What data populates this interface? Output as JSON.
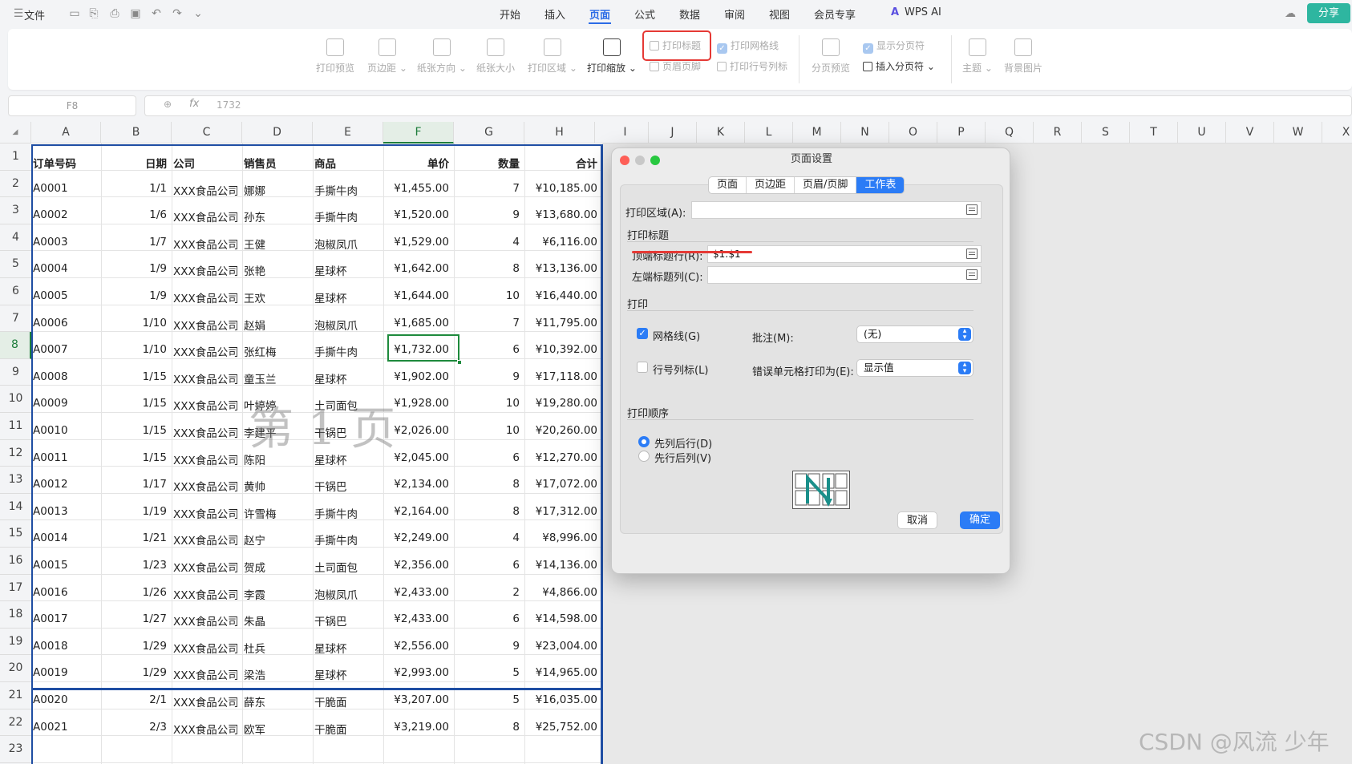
{
  "titlebar": {
    "file_menu": "文件",
    "tabs": [
      "开始",
      "插入",
      "页面",
      "公式",
      "数据",
      "审阅",
      "视图",
      "会员专享"
    ],
    "active_tab": "页面",
    "wps_ai": "WPS AI",
    "share": "分享"
  },
  "ribbon": {
    "print_preview": "打印预览",
    "margins": "页边距",
    "orientation": "纸张方向",
    "paper_size": "纸张大小",
    "print_area": "打印区域",
    "print_scale": "打印缩放",
    "print_titles": "打印标题",
    "header_footer": "页眉页脚",
    "print_gridlines": "打印网格线",
    "print_row_col_headers": "打印行号列标",
    "page_break_preview": "分页预览",
    "show_page_breaks": "显示分页符",
    "insert_page_break": "插入分页符",
    "theme": "主题",
    "background_image": "背景图片"
  },
  "formula_bar": {
    "name_box": "F8",
    "fx": "fx",
    "value": "1732"
  },
  "sheet": {
    "columns": [
      "A",
      "B",
      "C",
      "D",
      "E",
      "F",
      "G",
      "H",
      "I",
      "J",
      "K",
      "L",
      "M",
      "N",
      "O",
      "P",
      "Q",
      "R",
      "S",
      "T",
      "U",
      "V",
      "W",
      "X"
    ],
    "active_column": "F",
    "active_row": "8",
    "row_numbers": [
      "1",
      "2",
      "3",
      "4",
      "5",
      "6",
      "7",
      "8",
      "9",
      "10",
      "11",
      "12",
      "13",
      "14",
      "15",
      "16",
      "17",
      "18",
      "19",
      "20",
      "21",
      "22",
      "23"
    ],
    "headers": [
      "订单号码",
      "日期",
      "公司",
      "销售员",
      "商品",
      "单价",
      "数量",
      "合计"
    ],
    "rows": [
      [
        "A0001",
        "1/1",
        "XXX食品公司",
        "娜娜",
        "手撕牛肉",
        "¥1,455.00",
        "7",
        "¥10,185.00"
      ],
      [
        "A0002",
        "1/6",
        "XXX食品公司",
        "孙东",
        "手撕牛肉",
        "¥1,520.00",
        "9",
        "¥13,680.00"
      ],
      [
        "A0003",
        "1/7",
        "XXX食品公司",
        "王健",
        "泡椒凤爪",
        "¥1,529.00",
        "4",
        "¥6,116.00"
      ],
      [
        "A0004",
        "1/9",
        "XXX食品公司",
        "张艳",
        "星球杯",
        "¥1,642.00",
        "8",
        "¥13,136.00"
      ],
      [
        "A0005",
        "1/9",
        "XXX食品公司",
        "王欢",
        "星球杯",
        "¥1,644.00",
        "10",
        "¥16,440.00"
      ],
      [
        "A0006",
        "1/10",
        "XXX食品公司",
        "赵娟",
        "泡椒凤爪",
        "¥1,685.00",
        "7",
        "¥11,795.00"
      ],
      [
        "A0007",
        "1/10",
        "XXX食品公司",
        "张红梅",
        "手撕牛肉",
        "¥1,732.00",
        "6",
        "¥10,392.00"
      ],
      [
        "A0008",
        "1/15",
        "XXX食品公司",
        "童玉兰",
        "星球杯",
        "¥1,902.00",
        "9",
        "¥17,118.00"
      ],
      [
        "A0009",
        "1/15",
        "XXX食品公司",
        "叶婷婷",
        "土司面包",
        "¥1,928.00",
        "10",
        "¥19,280.00"
      ],
      [
        "A0010",
        "1/15",
        "XXX食品公司",
        "李建平",
        "干锅巴",
        "¥2,026.00",
        "10",
        "¥20,260.00"
      ],
      [
        "A0011",
        "1/15",
        "XXX食品公司",
        "陈阳",
        "星球杯",
        "¥2,045.00",
        "6",
        "¥12,270.00"
      ],
      [
        "A0012",
        "1/17",
        "XXX食品公司",
        "黄帅",
        "干锅巴",
        "¥2,134.00",
        "8",
        "¥17,072.00"
      ],
      [
        "A0013",
        "1/19",
        "XXX食品公司",
        "许雪梅",
        "手撕牛肉",
        "¥2,164.00",
        "8",
        "¥17,312.00"
      ],
      [
        "A0014",
        "1/21",
        "XXX食品公司",
        "赵宁",
        "手撕牛肉",
        "¥2,249.00",
        "4",
        "¥8,996.00"
      ],
      [
        "A0015",
        "1/23",
        "XXX食品公司",
        "贺成",
        "土司面包",
        "¥2,356.00",
        "6",
        "¥14,136.00"
      ],
      [
        "A0016",
        "1/26",
        "XXX食品公司",
        "李霞",
        "泡椒凤爪",
        "¥2,433.00",
        "2",
        "¥4,866.00"
      ],
      [
        "A0017",
        "1/27",
        "XXX食品公司",
        "朱晶",
        "干锅巴",
        "¥2,433.00",
        "6",
        "¥14,598.00"
      ],
      [
        "A0018",
        "1/29",
        "XXX食品公司",
        "杜兵",
        "星球杯",
        "¥2,556.00",
        "9",
        "¥23,004.00"
      ],
      [
        "A0019",
        "1/29",
        "XXX食品公司",
        "梁浩",
        "星球杯",
        "¥2,993.00",
        "5",
        "¥14,965.00"
      ],
      [
        "A0020",
        "2/1",
        "XXX食品公司",
        "薛东",
        "干脆面",
        "¥3,207.00",
        "5",
        "¥16,035.00"
      ],
      [
        "A0021",
        "2/3",
        "XXX食品公司",
        "欧军",
        "干脆面",
        "¥3,219.00",
        "8",
        "¥25,752.00"
      ]
    ],
    "page_watermark": "第 1 页"
  },
  "dialog": {
    "title": "页面设置",
    "tabs": [
      "页面",
      "页边距",
      "页眉/页脚",
      "工作表"
    ],
    "active_tab": "工作表",
    "print_area_label": "打印区域(A):",
    "print_area_value": "",
    "print_titles_section": "打印标题",
    "top_rows_label": "顶端标题行(R):",
    "top_rows_value": "$1:$1",
    "left_cols_label": "左端标题列(C):",
    "left_cols_value": "",
    "print_section": "打印",
    "gridlines_label": "网格线(G)",
    "gridlines_checked": true,
    "row_col_headers_label": "行号列标(L)",
    "row_col_headers_checked": false,
    "comments_label": "批注(M):",
    "comments_value": "(无)",
    "errors_label": "错误单元格打印为(E):",
    "errors_value": "显示值",
    "order_section": "打印顺序",
    "order_down_then_over": "先列后行(D)",
    "order_over_then_down": "先行后列(V)",
    "order_selected": "先列后行(D)",
    "cancel": "取消",
    "ok": "确定"
  },
  "colors": {
    "accent": "#2b7cf6",
    "active_tab": "#2b6be6",
    "highlight": "#e53935",
    "selection": "#1e8a3c",
    "page_break": "#1f4ea3",
    "share": "#2eb6a0"
  },
  "footer_watermark": "CSDN @风流 少年"
}
